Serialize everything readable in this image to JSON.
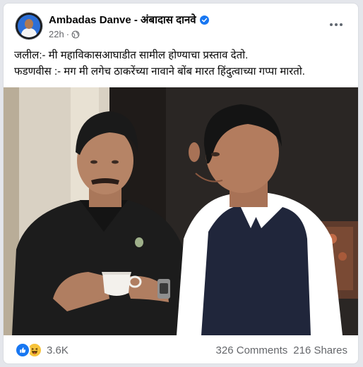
{
  "post": {
    "author_name": "Ambadas Danve - अंबादास दानवे",
    "time": "22h",
    "meta_separator": "·",
    "audience_icon": "globe-icon",
    "verified_icon": "verified-badge-icon",
    "more_icon": "more-options-icon",
    "text_lines": [
      "जलील:- मी महाविकासआघाडीत सामील होण्याचा प्रस्ताव देतो.",
      "फडणवीस :- मग मी लगेच ठाकरेंच्या नावाने बोंब मारत हिंदुत्वाच्या गप्पा मारतो."
    ],
    "photo_icon": "post-photo"
  },
  "footer": {
    "reaction_icons": [
      "like-icon",
      "haha-icon"
    ],
    "reaction_count": "3.6K",
    "comments": "326 Comments",
    "shares": "216 Shares"
  },
  "colors": {
    "brand_blue": "#1877f2",
    "text_primary": "#050505",
    "text_secondary": "#65676b",
    "haha_yellow": "#f7c33a"
  }
}
